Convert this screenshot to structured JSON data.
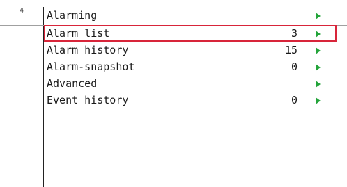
{
  "gutter": {
    "number": "4"
  },
  "menu": {
    "title": "Alarming",
    "items": [
      {
        "label": "Alarm list",
        "count": "3",
        "selected": true
      },
      {
        "label": "Alarm history",
        "count": "15",
        "selected": false
      },
      {
        "label": "Alarm-snapshot",
        "count": "0",
        "selected": false
      },
      {
        "label": "Advanced",
        "count": "",
        "selected": false
      },
      {
        "label": "Event history",
        "count": "0",
        "selected": false
      }
    ]
  },
  "colors": {
    "arrow": "#23a43a",
    "selection_border": "#d8253a"
  },
  "icons": {
    "arrow": "right-triangle-icon"
  }
}
